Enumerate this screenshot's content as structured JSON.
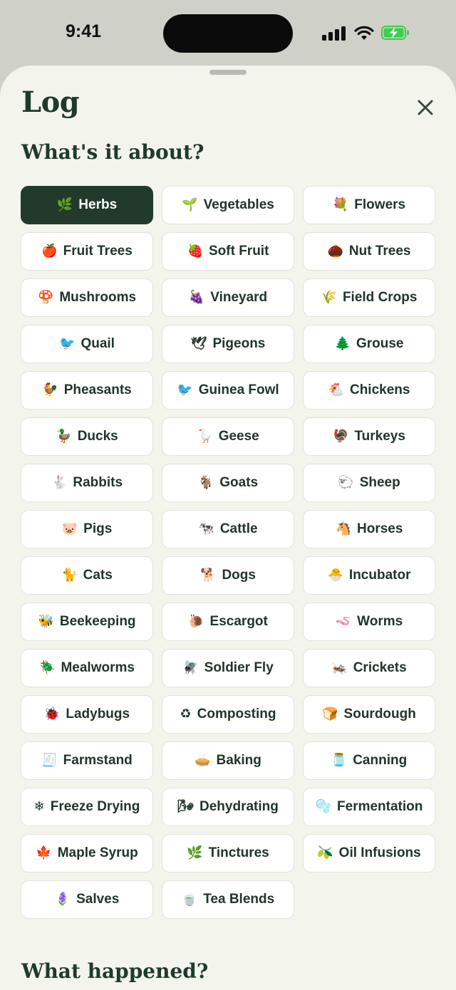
{
  "status_bar": {
    "time": "9:41"
  },
  "sheet": {
    "title": "Log",
    "close_icon": "close-x-icon",
    "section_about": "What's it about?",
    "section_happened": "What happened?"
  },
  "categories": [
    {
      "label": "Herbs",
      "emoji": "🌿",
      "selected": true
    },
    {
      "label": "Vegetables",
      "emoji": "🌱"
    },
    {
      "label": "Flowers",
      "emoji": "💐"
    },
    {
      "label": "Fruit Trees",
      "emoji": "🍎"
    },
    {
      "label": "Soft Fruit",
      "emoji": "🍓"
    },
    {
      "label": "Nut Trees",
      "emoji": "🌰"
    },
    {
      "label": "Mushrooms",
      "emoji": "🍄"
    },
    {
      "label": "Vineyard",
      "emoji": "🍇"
    },
    {
      "label": "Field Crops",
      "emoji": "🌾"
    },
    {
      "label": "Quail",
      "emoji": "🐦"
    },
    {
      "label": "Pigeons",
      "emoji": "🕊"
    },
    {
      "label": "Grouse",
      "emoji": "🌲"
    },
    {
      "label": "Pheasants",
      "emoji": "🐓"
    },
    {
      "label": "Guinea Fowl",
      "emoji": "🐦"
    },
    {
      "label": "Chickens",
      "emoji": "🐔"
    },
    {
      "label": "Ducks",
      "emoji": "🦆"
    },
    {
      "label": "Geese",
      "emoji": "🪿"
    },
    {
      "label": "Turkeys",
      "emoji": "🦃"
    },
    {
      "label": "Rabbits",
      "emoji": "🐇"
    },
    {
      "label": "Goats",
      "emoji": "🐐"
    },
    {
      "label": "Sheep",
      "emoji": "🐑"
    },
    {
      "label": "Pigs",
      "emoji": "🐷"
    },
    {
      "label": "Cattle",
      "emoji": "🐄"
    },
    {
      "label": "Horses",
      "emoji": "🐴"
    },
    {
      "label": "Cats",
      "emoji": "🐈"
    },
    {
      "label": "Dogs",
      "emoji": "🐕"
    },
    {
      "label": "Incubator",
      "emoji": "🐣"
    },
    {
      "label": "Beekeeping",
      "emoji": "🐝"
    },
    {
      "label": "Escargot",
      "emoji": "🐌"
    },
    {
      "label": "Worms",
      "emoji": "🪱"
    },
    {
      "label": "Mealworms",
      "emoji": "🪲"
    },
    {
      "label": "Soldier Fly",
      "emoji": "🪰"
    },
    {
      "label": "Crickets",
      "emoji": "🦗"
    },
    {
      "label": "Ladybugs",
      "emoji": "🐞"
    },
    {
      "label": "Composting",
      "emoji": "♻"
    },
    {
      "label": "Sourdough",
      "emoji": "🍞"
    },
    {
      "label": "Farmstand",
      "emoji": "🧾"
    },
    {
      "label": "Baking",
      "emoji": "🥧"
    },
    {
      "label": "Canning",
      "emoji": "🫙"
    },
    {
      "label": "Freeze Drying",
      "emoji": "❄"
    },
    {
      "label": "Dehydrating",
      "emoji": "🌬"
    },
    {
      "label": "Fermentation",
      "emoji": "🫧"
    },
    {
      "label": "Maple Syrup",
      "emoji": "🍁"
    },
    {
      "label": "Tinctures",
      "emoji": "🌿"
    },
    {
      "label": "Oil Infusions",
      "emoji": "🫒"
    },
    {
      "label": "Salves",
      "emoji": "🪻"
    },
    {
      "label": "Tea Blends",
      "emoji": "🍵"
    }
  ],
  "colors": {
    "accent": "#223a2b",
    "sheet_bg": "#f3f4ec",
    "chip_bg": "#ffffff",
    "battery_green": "#3ccf4e"
  }
}
